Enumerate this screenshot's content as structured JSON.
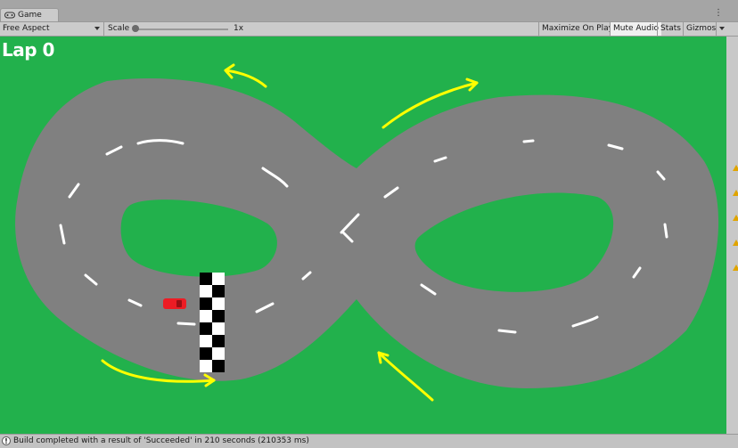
{
  "tab": {
    "label": "Game",
    "icon": "gamepad-icon"
  },
  "toolbar": {
    "aspect": "Free Aspect",
    "scale_label": "Scale",
    "scale_value": "1x",
    "maximize": "Maximize On Play",
    "mute": "Mute Audio",
    "stats": "Stats",
    "gizmos": "Gizmos"
  },
  "game": {
    "lap": "Lap 0",
    "colors": {
      "grass": "#22b14c",
      "track": "#808080",
      "arrow": "#ffff00",
      "car": "#ed1c24"
    }
  },
  "status": {
    "message": "Build completed with a result of 'Succeeded' in 210 seconds (210353 ms)"
  }
}
